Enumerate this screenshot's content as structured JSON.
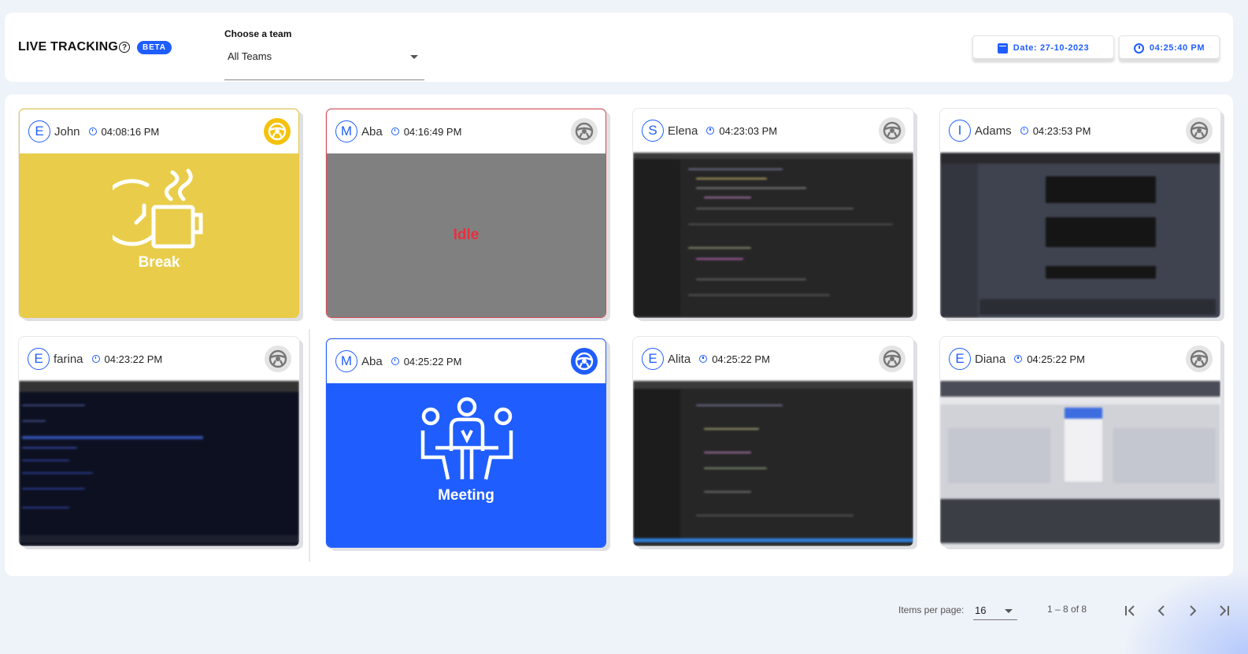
{
  "header": {
    "title": "LIVE TRACKING",
    "help_icon": "help-circle-icon",
    "beta": "BETA",
    "team_label": "Choose a team",
    "team_value": "All Teams",
    "date": "Date: 27-10-2023",
    "time": "04:25:40 PM"
  },
  "colors": {
    "accent": "#1f5dfe",
    "break": "#e9cd4a",
    "idle_bg": "#808080",
    "idle_text": "#e8303f",
    "meeting": "#1f5dfe"
  },
  "cards": [
    {
      "initial": "E",
      "name": "John",
      "time": "04:08:16 PM",
      "status": "break",
      "label": "Break"
    },
    {
      "initial": "M",
      "name": "Aba",
      "time": "04:16:49 PM",
      "status": "idle",
      "label": "Idle"
    },
    {
      "initial": "S",
      "name": "Elena",
      "time": "04:23:03 PM",
      "status": "screen"
    },
    {
      "initial": "I",
      "name": "Adams",
      "time": "04:23:53 PM",
      "status": "screen"
    },
    {
      "initial": "E",
      "name": "farina",
      "time": "04:23:22 PM",
      "status": "screen"
    },
    {
      "initial": "M",
      "name": "Aba",
      "time": "04:25:22 PM",
      "status": "meeting",
      "label": "Meeting"
    },
    {
      "initial": "E",
      "name": "Alita",
      "time": "04:25:22 PM",
      "status": "screen"
    },
    {
      "initial": "E",
      "name": "Diana",
      "time": "04:25:22 PM",
      "status": "screen"
    }
  ],
  "pagination": {
    "items_per_page_label": "Items per page:",
    "items_per_page": "16",
    "range": "1 – 8 of 8"
  }
}
